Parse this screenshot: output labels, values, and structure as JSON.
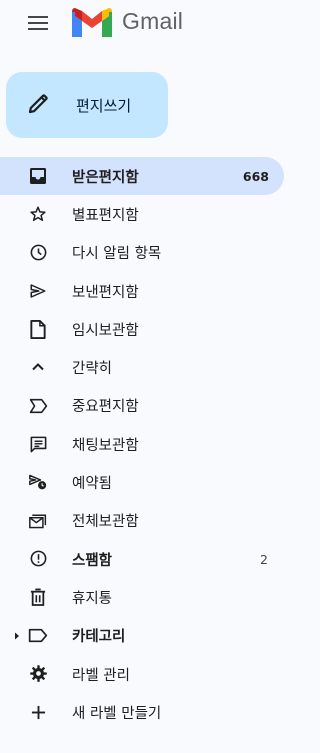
{
  "header": {
    "brand": "Gmail"
  },
  "compose": {
    "label": "편지쓰기"
  },
  "nav": {
    "items": [
      {
        "label": "받은편지함",
        "count": "668",
        "icon": "inbox-icon"
      },
      {
        "label": "별표편지함",
        "icon": "star-icon"
      },
      {
        "label": "다시 알림 항목",
        "icon": "clock-icon"
      },
      {
        "label": "보낸편지함",
        "icon": "send-icon"
      },
      {
        "label": "임시보관함",
        "icon": "draft-icon"
      },
      {
        "label": "간략히",
        "icon": "chevron-up-icon"
      },
      {
        "label": "중요편지함",
        "icon": "label-important-icon"
      },
      {
        "label": "채팅보관함",
        "icon": "chat-icon"
      },
      {
        "label": "예약됨",
        "icon": "scheduled-send-icon"
      },
      {
        "label": "전체보관함",
        "icon": "all-mail-icon"
      },
      {
        "label": "스팸함",
        "count": "2",
        "icon": "spam-icon"
      },
      {
        "label": "휴지통",
        "icon": "trash-icon"
      },
      {
        "label": "카테고리",
        "icon": "label-icon"
      },
      {
        "label": "라벨 관리",
        "icon": "settings-icon"
      },
      {
        "label": "새 라벨 만들기",
        "icon": "plus-icon"
      }
    ]
  },
  "colors": {
    "background": "#f8fafd",
    "compose_bg": "#c2e7ff",
    "active_bg": "#d3e3fd"
  }
}
